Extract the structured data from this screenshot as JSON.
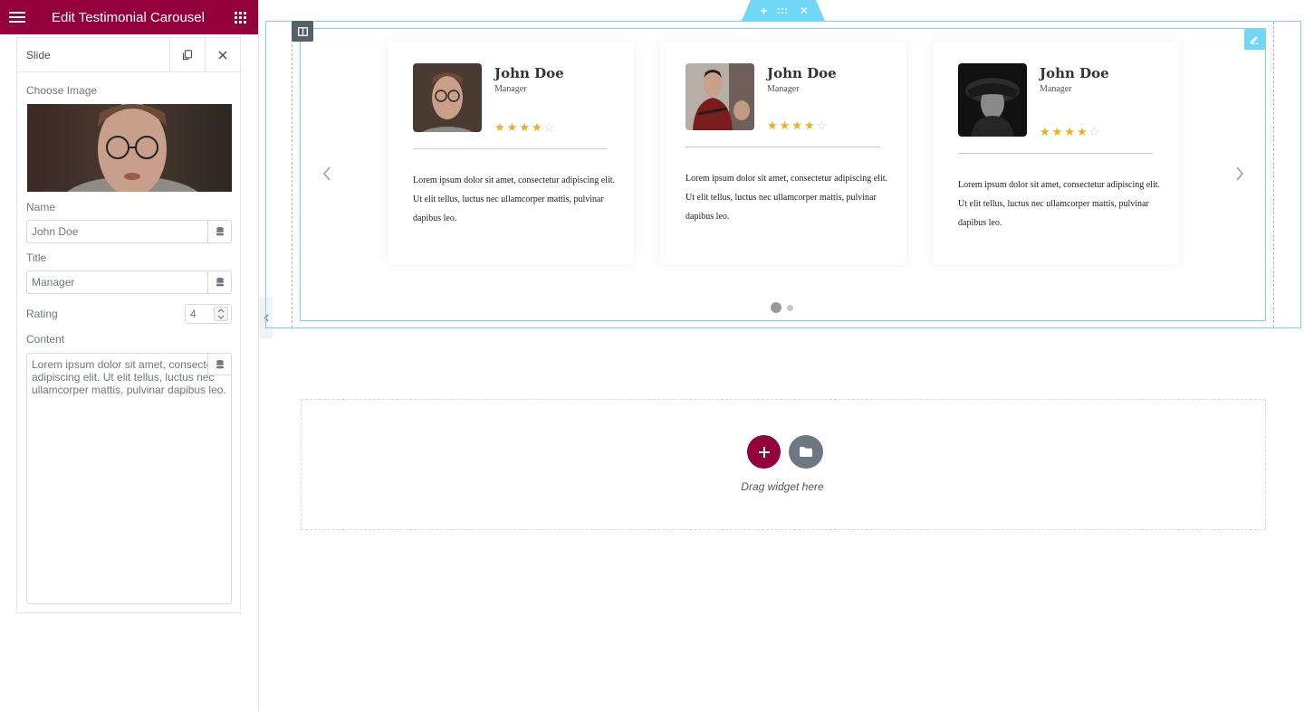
{
  "colors": {
    "brand": "#93003c",
    "selection": "#71d7f7",
    "star": "#f0ad1e"
  },
  "editor": {
    "title": "Edit Testimonial Carousel",
    "icons": {
      "menu": "hamburger-icon",
      "grid": "apps-grid-icon"
    }
  },
  "panel": {
    "header_label": "Slide",
    "labels": {
      "image": "Choose Image",
      "name": "Name",
      "title": "Title",
      "rating": "Rating",
      "content": "Content"
    },
    "name_value": "John Doe",
    "title_value": "Manager",
    "rating_value": "4",
    "content_value": "Lorem ipsum dolor sit amet, consectet adipiscing elit. Ut elit tellus, luctus nec ullamcorper mattis, pulvinar dapibus leo."
  },
  "carousel": {
    "slides": [
      {
        "name": "John Doe",
        "role": "Manager",
        "rating": 4,
        "text": "Lorem ipsum dolor sit amet, consectetur adipiscing elit. Ut elit tellus, luctus nec ullamcorper mattis, pulvinar dapibus leo."
      },
      {
        "name": "John Doe",
        "role": "Manager",
        "rating": 4,
        "text": "Lorem ipsum dolor sit amet, consectetur adipiscing elit. Ut elit tellus, luctus nec ullamcorper mattis, pulvinar dapibus leo."
      },
      {
        "name": "John Doe",
        "role": "Manager",
        "rating": 4,
        "text": "Lorem ipsum dolor sit amet, consectetur adipiscing elit. Ut elit tellus, luctus nec ullamcorper mattis, pulvinar dapibus leo."
      }
    ],
    "pagination": {
      "pages": 2,
      "active": 1
    }
  },
  "drop_zone": {
    "text": "Drag widget here"
  }
}
